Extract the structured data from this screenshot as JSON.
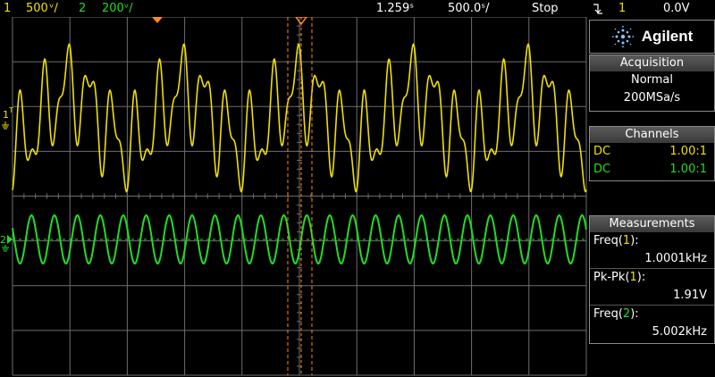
{
  "status_bar": {
    "ch1_num": "1",
    "ch1_scale": "500 ᵛ/",
    "ch2_num": "2",
    "ch2_scale": "200ᵛ/",
    "delay": "1.259ˢ",
    "timebase": "500.0ˢ/",
    "run_state": "Stop",
    "trigger_icon": "trigger-edge-falling-icon",
    "trigger_source": "1",
    "trigger_level": "0.0V"
  },
  "brand": {
    "logo": "spark-logo-icon",
    "name": "Agilent"
  },
  "acquisition": {
    "header": "Acquisition",
    "mode": "Normal",
    "rate": "200MSa/s"
  },
  "channels": {
    "header": "Channels",
    "items": [
      {
        "coupling": "DC",
        "probe": "1.00:1",
        "color": "#f0e000"
      },
      {
        "coupling": "DC",
        "probe": "1.00:1",
        "color": "#22dd22"
      }
    ]
  },
  "measurements": {
    "header": "Measurements",
    "items": [
      {
        "name": "Freq",
        "channel": "1",
        "value": "1.0001kHz"
      },
      {
        "name": "Pk-Pk",
        "channel": "1",
        "value": "1.91V"
      },
      {
        "name": "Freq",
        "channel": "2",
        "value": "5.002kHz"
      }
    ]
  },
  "markers": {
    "ch1": "1",
    "ch2": "2",
    "trigger": "T"
  },
  "colors": {
    "ch1": "#f0e000",
    "ch2": "#22dd22",
    "cursor": "#ff8a1a",
    "grid": "#6e6e6e",
    "panel_border": "#8a8a8a"
  },
  "chart_data": {
    "type": "line",
    "time_per_div": "500.0µs",
    "grid": true,
    "series": [
      {
        "channel": "1",
        "volts_per_div": "500mV",
        "freq_khz": 1.0001,
        "pk_pk_v": 1.91
      },
      {
        "channel": "2",
        "volts_per_div": "200mV",
        "freq_khz": 5.002
      }
    ]
  }
}
